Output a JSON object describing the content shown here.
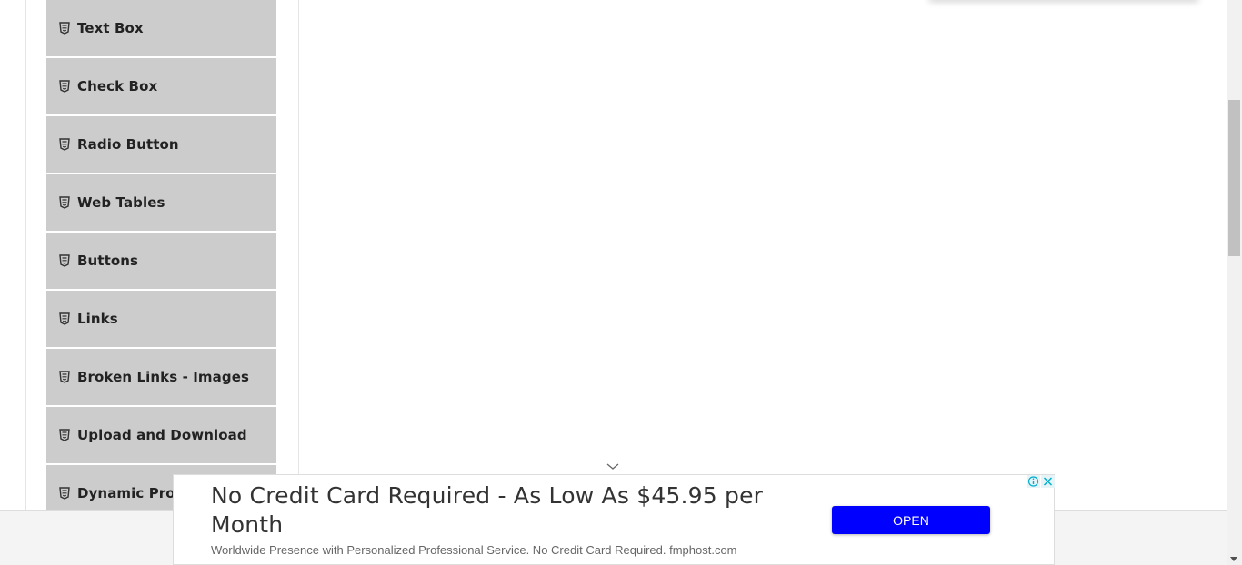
{
  "sidebar": {
    "items": [
      {
        "label": "Text Box",
        "icon": "html5-icon"
      },
      {
        "label": "Check Box",
        "icon": "html5-icon"
      },
      {
        "label": "Radio Button",
        "icon": "html5-icon"
      },
      {
        "label": "Web Tables",
        "icon": "html5-icon"
      },
      {
        "label": "Buttons",
        "icon": "html5-icon"
      },
      {
        "label": "Links",
        "icon": "html5-icon"
      },
      {
        "label": "Broken Links - Images",
        "icon": "html5-icon"
      },
      {
        "label": "Upload and Download",
        "icon": "html5-icon"
      },
      {
        "label": "Dynamic Properties",
        "icon": "html5-icon"
      }
    ]
  },
  "ad": {
    "title": "No Credit Card Required - As Low As $45.95 per Month",
    "description": "Worldwide Presence with Personalized Professional Service. No Credit Card Required. fmphost.com",
    "cta_label": "OPEN",
    "cta_color": "#0000ff"
  },
  "colors": {
    "menu_bg": "#cccccc",
    "menu_text": "#222222"
  }
}
